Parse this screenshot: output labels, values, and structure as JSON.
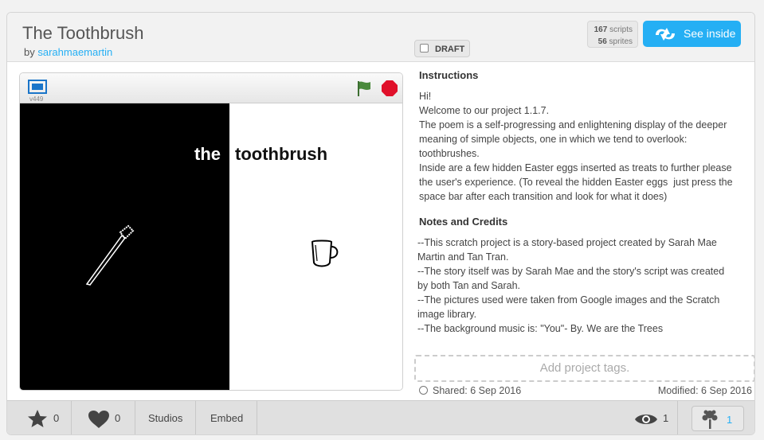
{
  "project": {
    "title": "The Toothbrush",
    "by_prefix": "by",
    "author": "sarahmaemartin",
    "draft_label": "DRAFT",
    "scripts_count": "167",
    "scripts_label": "scripts",
    "sprites_count": "56",
    "sprites_label": "sprites",
    "see_inside_label": "See inside"
  },
  "player": {
    "version": "v449",
    "stage_word_left": "the",
    "stage_word_right": "toothbrush"
  },
  "instructions": {
    "title": "Instructions",
    "lines": [
      "Hi!",
      "Welcome to our project 1.1.7.",
      "The poem is a self-progressing and enlightening display of the deeper",
      "meaning of simple objects, one in which we tend to overlook:",
      "toothbrushes.",
      "Inside are a few hidden Easter eggs inserted as treats to further please",
      "the user's experience. (To reveal the hidden Easter eggs  just press the",
      "space bar after each transition and look for what it does)"
    ]
  },
  "notes": {
    "title": "Notes and Credits",
    "lines": [
      "--This scratch project is a story-based project created by Sarah Mae",
      "Martin and Tan Tran.",
      "--The story itself was by Sarah Mae and the story's script was created",
      "by both Tan and Sarah.",
      "--The pictures used were taken from Google images and the Scratch",
      "image library.",
      "--The background music is: \"You\"- By. We are the Trees"
    ]
  },
  "tags_placeholder": "Add project tags.",
  "shared": "Shared: 6 Sep 2016",
  "modified": "Modified: 6 Sep 2016",
  "footer": {
    "stars": "0",
    "loves": "0",
    "studios_label": "Studios",
    "embed_label": "Embed",
    "views": "1",
    "remixes": "1"
  },
  "colors": {
    "accent": "#25aff4",
    "flag": "#4a8a3c",
    "stop": "#e0102a"
  },
  "icons": [
    "fullscreen-icon",
    "green-flag-icon",
    "stop-icon",
    "see-inside-icon",
    "star-icon",
    "heart-icon",
    "eye-icon",
    "remix-tree-icon",
    "clock-icon"
  ]
}
